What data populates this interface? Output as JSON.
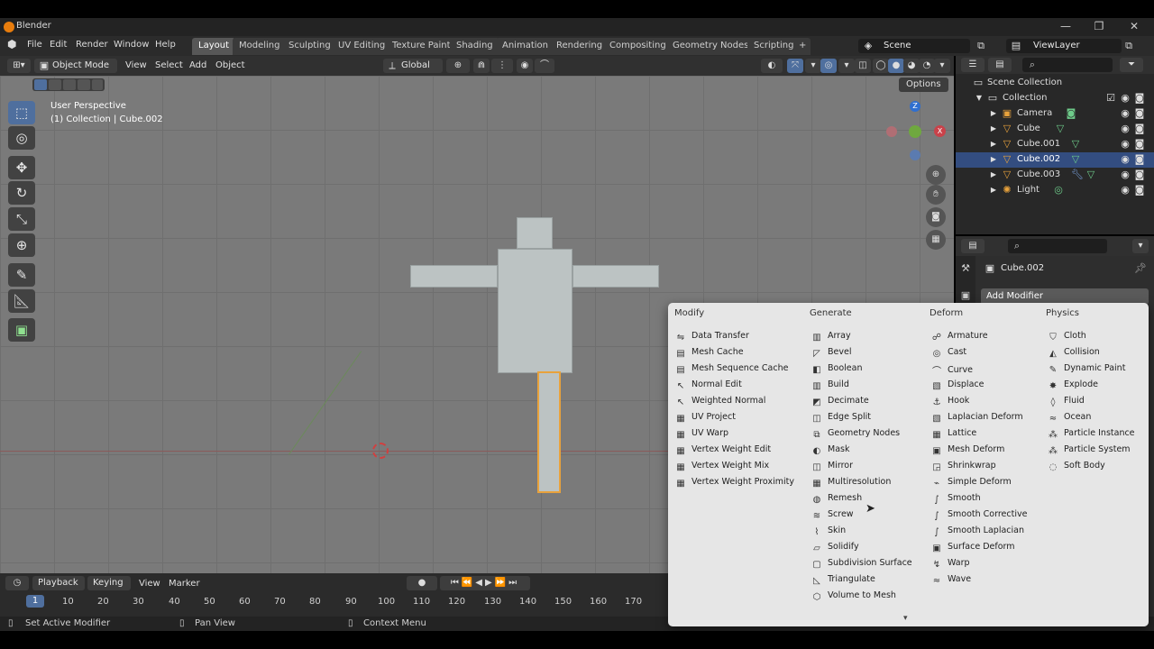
{
  "window": {
    "title": "Blender",
    "minimize": "—",
    "maximize": "❐",
    "close": "✕"
  },
  "menubar": [
    "File",
    "Edit",
    "Render",
    "Window",
    "Help"
  ],
  "workspaces": [
    "Layout",
    "Modeling",
    "Sculpting",
    "UV Editing",
    "Texture Paint",
    "Shading",
    "Animation",
    "Rendering",
    "Compositing",
    "Geometry Nodes",
    "Scripting"
  ],
  "workspace_add": "+",
  "scene": "Scene",
  "view_layer": "ViewLayer",
  "viewport_header": {
    "mode": "Object Mode",
    "menus": [
      "View",
      "Select",
      "Add",
      "Object"
    ],
    "orientation": "Global",
    "options": "Options"
  },
  "viewport_overlay": {
    "line1": "User Perspective",
    "line2": "(1) Collection | Cube.002"
  },
  "gizmo": {
    "z": "Z",
    "x": "X"
  },
  "outliner": {
    "root": "Scene Collection",
    "collection": "Collection",
    "items": [
      {
        "label": "Camera",
        "selected": false
      },
      {
        "label": "Cube",
        "selected": false
      },
      {
        "label": "Cube.001",
        "selected": false
      },
      {
        "label": "Cube.002",
        "selected": true
      },
      {
        "label": "Cube.003",
        "selected": false
      },
      {
        "label": "Light",
        "selected": false
      }
    ]
  },
  "properties": {
    "object_name": "Cube.002",
    "add_modifier": "Add Modifier"
  },
  "popup": {
    "columns": [
      {
        "heading": "Modify",
        "items": [
          "Data Transfer",
          "Mesh Cache",
          "Mesh Sequence Cache",
          "Normal Edit",
          "Weighted Normal",
          "UV Project",
          "UV Warp",
          "Vertex Weight Edit",
          "Vertex Weight Mix",
          "Vertex Weight Proximity"
        ]
      },
      {
        "heading": "Generate",
        "items": [
          "Array",
          "Bevel",
          "Boolean",
          "Build",
          "Decimate",
          "Edge Split",
          "Geometry Nodes",
          "Mask",
          "Mirror",
          "Multiresolution",
          "Remesh",
          "Screw",
          "Skin",
          "Solidify",
          "Subdivision Surface",
          "Triangulate",
          "Volume to Mesh"
        ]
      },
      {
        "heading": "Deform",
        "items": [
          "Armature",
          "Cast",
          "Curve",
          "Displace",
          "Hook",
          "Laplacian Deform",
          "Lattice",
          "Mesh Deform",
          "Shrinkwrap",
          "Simple Deform",
          "Smooth",
          "Smooth Corrective",
          "Smooth Laplacian",
          "Surface Deform",
          "Warp",
          "Wave"
        ]
      },
      {
        "heading": "Physics",
        "items": [
          "Cloth",
          "Collision",
          "Dynamic Paint",
          "Explode",
          "Fluid",
          "Ocean",
          "Particle Instance",
          "Particle System",
          "Soft Body"
        ]
      }
    ],
    "more_arrow": "▾"
  },
  "timeline": {
    "playback": "Playback",
    "keying": "Keying",
    "view": "View",
    "marker": "Marker",
    "current_frame": "1",
    "ticks": [
      "10",
      "20",
      "30",
      "40",
      "50",
      "60",
      "70",
      "80",
      "90",
      "100",
      "110",
      "120",
      "130",
      "140",
      "150",
      "160",
      "170"
    ]
  },
  "statusbar": {
    "left": "Set Active Modifier",
    "middle": "Pan View",
    "right": "Context Menu"
  },
  "colors": {
    "accent": "#4f6f9e",
    "selection_outline": "#e8a23c",
    "popup_bg": "#e6e6e6"
  }
}
